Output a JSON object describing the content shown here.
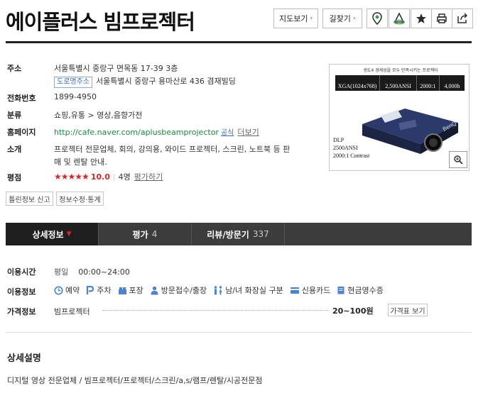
{
  "title": "에이플러스 빔프로젝터",
  "top_buttons": {
    "map": "지도보기",
    "route": "길찾기",
    "arrow": "›"
  },
  "info": {
    "address_label": "주소",
    "address": "서울특별시 중랑구 면목동 17-39 3층",
    "road_tag": "도로명주소",
    "road_address": "서울특별시 중랑구 용마산로 436 겸재빌딩",
    "phone_label": "전화번호",
    "phone": "1899-4950",
    "category_label": "분류",
    "category": "쇼핑,유통 > 영상,음향가전",
    "homepage_label": "홈페이지",
    "homepage": "http://cafe.naver.com/aplusbeamprojector",
    "official": "공식",
    "more": "더보기",
    "intro_label": "소개",
    "intro_line1": "프로젝터 전문업체, 회의, 강의용, 와이드 프로젝터, 스크린, 노트북 등 판",
    "intro_line2": "매 및 렌탈 안내.",
    "rating_label": "평점",
    "stars": "★★★★★",
    "score": "10.0",
    "raters": "4명",
    "rate_link": "평가하기"
  },
  "small_buttons": {
    "report": "틀린정보 신고",
    "edit": "정보수정·통계"
  },
  "photo": {
    "banner": "생도4 경제성을 모두 만족시키는 프로젝터",
    "specs": [
      "XGA(1024x768)",
      "2,500ANSI",
      "2000:1",
      "4,000h"
    ],
    "brand": "BenQ",
    "caption": [
      "DLP",
      "2500ANSI",
      "2000:1 Contrast"
    ]
  },
  "tabs": [
    {
      "label": "상세정보",
      "count": "",
      "caret": "▼"
    },
    {
      "label": "평가",
      "count": "4",
      "caret": ""
    },
    {
      "label": "리뷰/방문기",
      "count": "337",
      "caret": ""
    }
  ],
  "details": {
    "hours_label": "이용시간",
    "hours_day": "평일",
    "hours_time": "00:00~24:00",
    "facility_label": "이용정보",
    "facilities": [
      "예약",
      "주차",
      "포장",
      "방문접수/출장",
      "남/녀 화장실 구분",
      "신용카드",
      "현금영수증"
    ],
    "price_label": "가격정보",
    "price_item": "빔프로젝터",
    "price_value": "20~100원",
    "price_button": "가격표 보기"
  },
  "description": {
    "title": "상세설명",
    "body": "디지털 영상 전문업체 / 빔프로젝터/프로젝터/스크린/a,s/램프/렌탈/시공전문점"
  },
  "colors": {
    "accent_red": "#e02424",
    "tab_bg": "#3c3c3c",
    "link_green": "#1b8a3c",
    "icon_blue": "#4a82d6"
  }
}
